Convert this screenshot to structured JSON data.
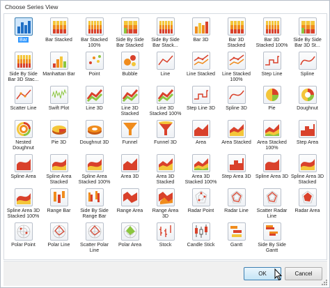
{
  "dialog": {
    "title": "Choose Series View",
    "ok_label": "OK",
    "cancel_label": "Cancel"
  },
  "colors": {
    "red": "#d9412b",
    "orange": "#f08c1d",
    "yellow": "#f4c63a",
    "green": "#8cc63f",
    "blue": "#3399ff",
    "selection": "#3399ff"
  },
  "series_views": [
    {
      "label": "Bar",
      "icon": "bar-icon",
      "selected": true
    },
    {
      "label": "Bar Stacked",
      "icon": "bar-stacked-icon"
    },
    {
      "label": "Bar Stacked\n100%",
      "icon": "bar-stacked-100-icon"
    },
    {
      "label": "Side By Side\nBar Stacked",
      "icon": "side-by-side-bar-stacked-icon"
    },
    {
      "label": "Side By Side\nBar Stack...",
      "icon": "side-by-side-bar-stacked-100-icon"
    },
    {
      "label": "Bar 3D",
      "icon": "bar-3d-icon"
    },
    {
      "label": "Bar 3D\nStacked",
      "icon": "bar-3d-stacked-icon"
    },
    {
      "label": "Bar 3D\nStacked 100%",
      "icon": "bar-3d-stacked-100-icon"
    },
    {
      "label": "Side By Side\nBar 3D St...",
      "icon": "side-by-side-bar-3d-stacked-icon"
    },
    {
      "label": "Side By Side\nBar 3D Stac...",
      "icon": "side-by-side-bar-3d-stacked-100-icon"
    },
    {
      "label": "Manhattan Bar",
      "icon": "manhattan-bar-icon"
    },
    {
      "label": "Point",
      "icon": "point-icon"
    },
    {
      "label": "Bubble",
      "icon": "bubble-icon"
    },
    {
      "label": "Line",
      "icon": "line-icon"
    },
    {
      "label": "Line Stacked",
      "icon": "line-stacked-icon"
    },
    {
      "label": "Line Stacked\n100%",
      "icon": "line-stacked-100-icon"
    },
    {
      "label": "Step Line",
      "icon": "step-line-icon"
    },
    {
      "label": "Spline",
      "icon": "spline-icon"
    },
    {
      "label": "Scatter Line",
      "icon": "scatter-line-icon"
    },
    {
      "label": "Swift Plot",
      "icon": "swift-plot-icon"
    },
    {
      "label": "Line 3D",
      "icon": "line-3d-icon"
    },
    {
      "label": "Line 3D\nStacked",
      "icon": "line-3d-stacked-icon"
    },
    {
      "label": "Line 3D\nStacked 100%",
      "icon": "line-3d-stacked-100-icon"
    },
    {
      "label": "Step Line 3D",
      "icon": "step-line-3d-icon"
    },
    {
      "label": "Spline 3D",
      "icon": "spline-3d-icon"
    },
    {
      "label": "Pie",
      "icon": "pie-icon"
    },
    {
      "label": "Doughnut",
      "icon": "doughnut-icon"
    },
    {
      "label": "Nested\nDoughnut",
      "icon": "nested-doughnut-icon"
    },
    {
      "label": "Pie 3D",
      "icon": "pie-3d-icon"
    },
    {
      "label": "Doughnut 3D",
      "icon": "doughnut-3d-icon"
    },
    {
      "label": "Funnel",
      "icon": "funnel-icon"
    },
    {
      "label": "Funnel 3D",
      "icon": "funnel-3d-icon"
    },
    {
      "label": "Area",
      "icon": "area-icon"
    },
    {
      "label": "Area Stacked",
      "icon": "area-stacked-icon"
    },
    {
      "label": "Area Stacked\n100%",
      "icon": "area-stacked-100-icon"
    },
    {
      "label": "Step Area",
      "icon": "step-area-icon"
    },
    {
      "label": "Spline Area",
      "icon": "spline-area-icon"
    },
    {
      "label": "Spline Area\nStacked",
      "icon": "spline-area-stacked-icon"
    },
    {
      "label": "Spline Area\nStacked 100%",
      "icon": "spline-area-stacked-100-icon"
    },
    {
      "label": "Area 3D",
      "icon": "area-3d-icon"
    },
    {
      "label": "Area 3D\nStacked",
      "icon": "area-3d-stacked-icon"
    },
    {
      "label": "Area 3D\nStacked 100%",
      "icon": "area-3d-stacked-100-icon"
    },
    {
      "label": "Step Area 3D",
      "icon": "step-area-3d-icon"
    },
    {
      "label": "Spline Area 3D",
      "icon": "spline-area-3d-icon"
    },
    {
      "label": "Spline Area 3D\nStacked",
      "icon": "spline-area-3d-stacked-icon"
    },
    {
      "label": "Spline Area 3D\nStacked 100%",
      "icon": "spline-area-3d-stacked-100-icon"
    },
    {
      "label": "Range Bar",
      "icon": "range-bar-icon"
    },
    {
      "label": "Side By Side\nRange Bar",
      "icon": "side-by-side-range-bar-icon"
    },
    {
      "label": "Range Area",
      "icon": "range-area-icon"
    },
    {
      "label": "Range Area\n3D",
      "icon": "range-area-3d-icon"
    },
    {
      "label": "Radar Point",
      "icon": "radar-point-icon"
    },
    {
      "label": "Radar Line",
      "icon": "radar-line-icon"
    },
    {
      "label": "Scatter Radar\nLine",
      "icon": "scatter-radar-line-icon"
    },
    {
      "label": "Radar Area",
      "icon": "radar-area-icon"
    },
    {
      "label": "Polar Point",
      "icon": "polar-point-icon"
    },
    {
      "label": "Polar Line",
      "icon": "polar-line-icon"
    },
    {
      "label": "Scatter Polar\nLine",
      "icon": "scatter-polar-line-icon"
    },
    {
      "label": "Polar Area",
      "icon": "polar-area-icon"
    },
    {
      "label": "Stock",
      "icon": "stock-icon"
    },
    {
      "label": "Candle Stick",
      "icon": "candle-stick-icon"
    },
    {
      "label": "Gantt",
      "icon": "gantt-icon"
    },
    {
      "label": "Side By Side\nGantt",
      "icon": "side-by-side-gantt-icon"
    }
  ]
}
